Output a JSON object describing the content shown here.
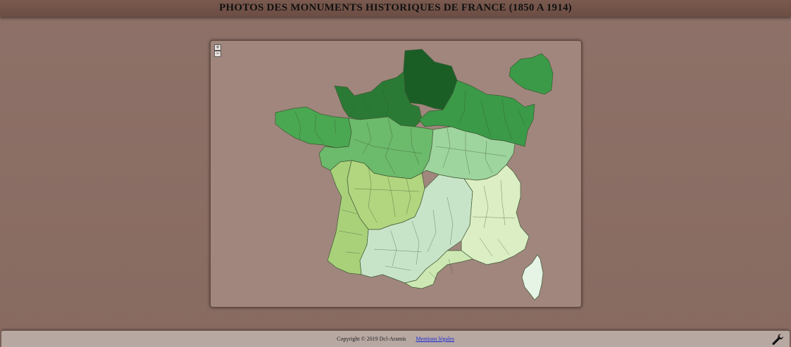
{
  "header": {
    "title": "PHOTOS DES MONUMENTS HISTORIQUES DE FRANCE (1850 A 1914)"
  },
  "map": {
    "zoom_in_label": "+",
    "zoom_out_label": "−",
    "colors": {
      "nord": "#1a5e26",
      "nord_ouest": "#2a7a35",
      "est": "#3a9a48",
      "bretagne": "#4aa852",
      "bassin_parisien": "#6cba6c",
      "centre_est": "#9ed49e",
      "centre_ouest": "#b2d57f",
      "atlantique": "#a9d17a",
      "massif_central": "#cde8b2",
      "sud_est": "#dceec4",
      "midi": "#c8e4c8",
      "corse": "#e6f4e6",
      "panel_bg": "#a0867d"
    }
  },
  "footer": {
    "copyright": "Copyright © 2019 Dcl-Aramis",
    "legal_link": "Mentions légales",
    "tools_icon": "wrench-icon"
  }
}
